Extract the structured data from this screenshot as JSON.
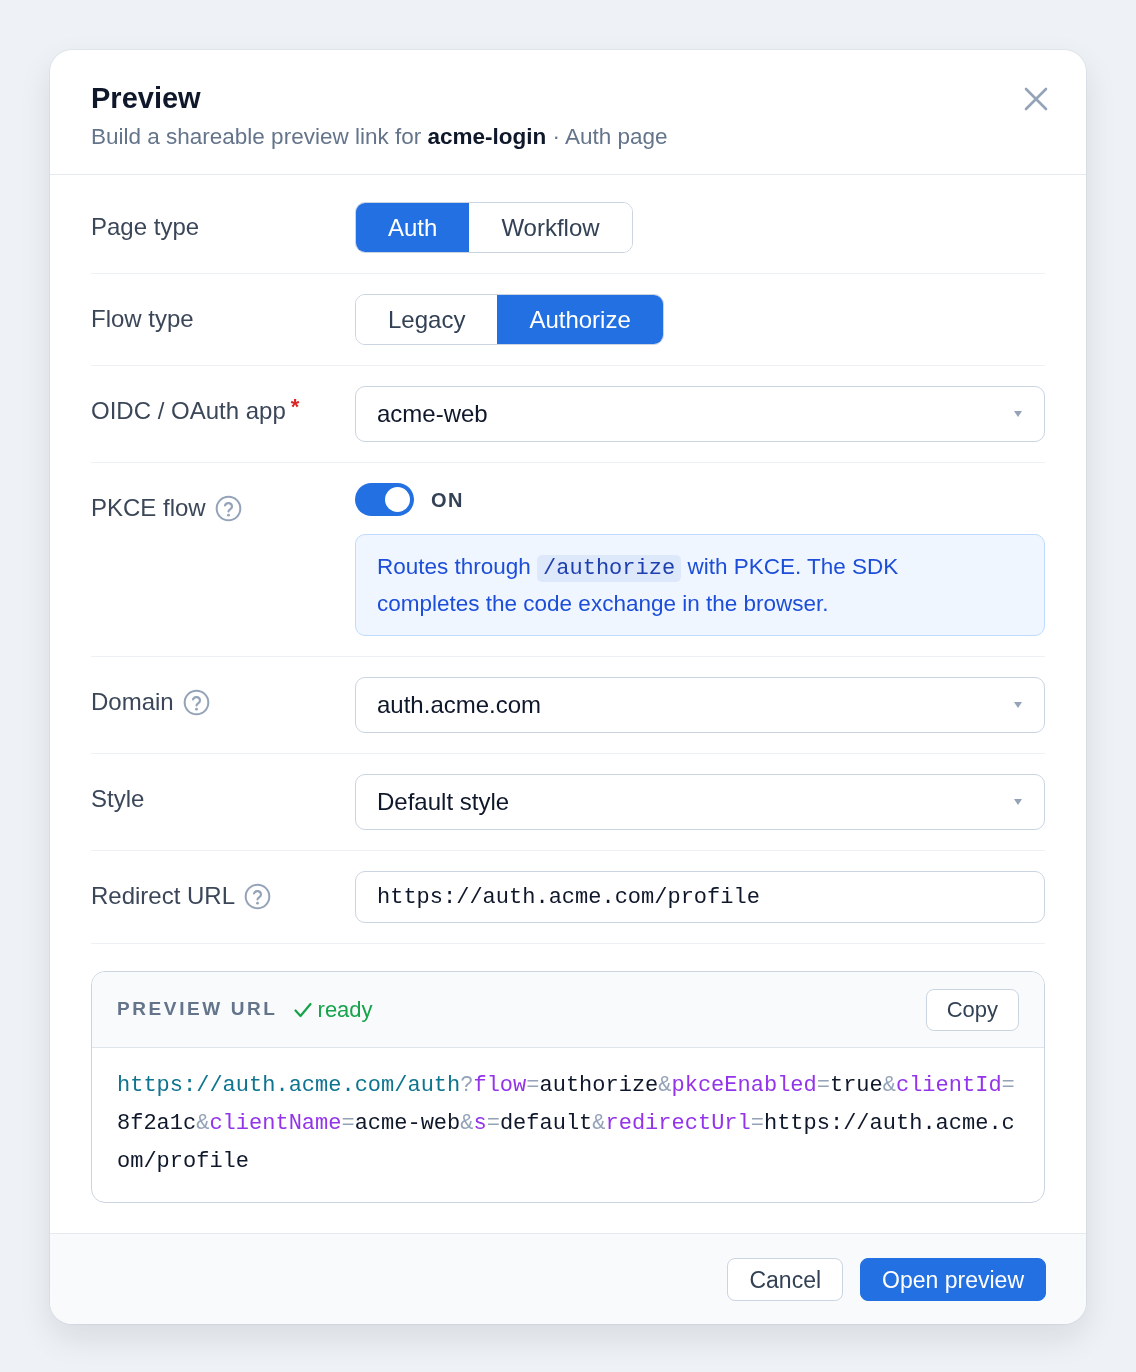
{
  "dialog": {
    "title": "Preview",
    "subtitle": "Build a shareable preview link for **acme-login** · Auth page"
  },
  "fields": [
    {
      "kind": "segmented",
      "label": "Page type",
      "help": false,
      "options": [
        {
          "label": "Auth",
          "selected": true
        },
        {
          "label": "Workflow",
          "selected": false
        }
      ]
    },
    {
      "kind": "segmented",
      "label": "Flow type",
      "help": false,
      "options": [
        {
          "label": "Legacy",
          "selected": false
        },
        {
          "label": "Authorize",
          "selected": true
        }
      ]
    },
    {
      "kind": "select",
      "label": "OIDC / OAuth app",
      "help": false,
      "required_mark": "*",
      "value": "acme-web"
    },
    {
      "kind": "toggle",
      "label": "PKCE flow",
      "help": true,
      "on": true,
      "state_label": "ON",
      "note": [
        {
          "kind": "text",
          "text": "Routes through "
        },
        {
          "kind": "code",
          "text": "/authorize"
        },
        {
          "kind": "text",
          "text": " with PKCE. The SDK completes the code exchange in the browser."
        }
      ]
    },
    {
      "kind": "select",
      "label": "Domain",
      "help": true,
      "value": "auth.acme.com"
    },
    {
      "kind": "select",
      "label": "Style",
      "help": false,
      "value": "Default style"
    },
    {
      "kind": "input",
      "label": "Redirect URL",
      "help": true,
      "value": "https://auth.acme.com/profile"
    }
  ],
  "preview": {
    "heading": "PREVIEW URL",
    "status": "ready",
    "copy_button": "Copy",
    "url_parts": [
      {
        "kind": "base",
        "text": "https://auth.acme.com/auth"
      },
      {
        "kind": "punct",
        "text": "?"
      },
      {
        "kind": "key",
        "text": "flow"
      },
      {
        "kind": "punct",
        "text": "="
      },
      {
        "kind": "value",
        "text": "authorize"
      },
      {
        "kind": "punct",
        "text": "&"
      },
      {
        "kind": "key",
        "text": "pkceEnabled"
      },
      {
        "kind": "punct",
        "text": "="
      },
      {
        "kind": "value",
        "text": "true"
      },
      {
        "kind": "punct",
        "text": "&"
      },
      {
        "kind": "key",
        "text": "clientId"
      },
      {
        "kind": "punct",
        "text": "="
      },
      {
        "kind": "value",
        "text": "8f2a1c"
      },
      {
        "kind": "punct",
        "text": "&"
      },
      {
        "kind": "key",
        "text": "clientName"
      },
      {
        "kind": "punct",
        "text": "="
      },
      {
        "kind": "value",
        "text": "acme-web"
      },
      {
        "kind": "punct",
        "text": "&"
      },
      {
        "kind": "key",
        "text": "s"
      },
      {
        "kind": "punct",
        "text": "="
      },
      {
        "kind": "value",
        "text": "default"
      },
      {
        "kind": "punct",
        "text": "&"
      },
      {
        "kind": "key",
        "text": "redirectUrl"
      },
      {
        "kind": "punct",
        "text": "="
      },
      {
        "kind": "value",
        "text": "https://auth.acme.com/profile"
      }
    ]
  },
  "footer": {
    "buttons": [
      {
        "label": "Cancel",
        "kind": "secondary"
      },
      {
        "label": "Open preview",
        "kind": "primary"
      }
    ]
  }
}
